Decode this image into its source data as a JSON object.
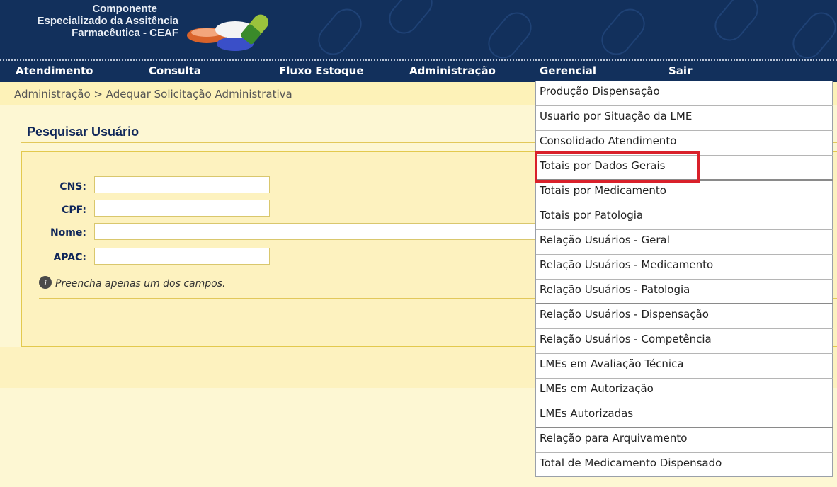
{
  "header": {
    "brand_line1": "Componente",
    "brand_line2": "Especializado da Assitência",
    "brand_line3": "Farmacêutica - CEAF"
  },
  "menu": {
    "atendimento": "Atendimento",
    "consulta": "Consulta",
    "fluxo_estoque": "Fluxo Estoque",
    "administracao": "Administração",
    "gerencial": "Gerencial",
    "sair": "Sair"
  },
  "breadcrumb": "Administração > Adequar Solicitação Administrativa",
  "form": {
    "title": "Pesquisar Usuário",
    "cns_label": "CNS:",
    "cpf_label": "CPF:",
    "nome_label": "Nome:",
    "apac_label": "APAC:",
    "cns_value": "",
    "cpf_value": "",
    "nome_value": "",
    "apac_value": "",
    "hint": "Preencha apenas um dos campos."
  },
  "gerencial_menu": {
    "items": [
      "Produção Dispensação",
      "Usuario por Situação da LME",
      "Consolidado Atendimento",
      "Totais por Dados Gerais",
      "Totais por Medicamento",
      "Totais por Patologia",
      "Relação Usuários - Geral",
      "Relação Usuários - Medicamento",
      "Relação Usuários - Patologia",
      "Relação Usuários - Dispensação",
      "Relação Usuários - Competência",
      "LMEs em Avaliação Técnica",
      "LMEs em Autorização",
      "LMEs Autorizadas",
      "Relação para Arquivamento",
      "Total de Medicamento Dispensado"
    ],
    "highlighted": "Totais por Dados Gerais"
  },
  "colors": {
    "header_bg": "#12305c",
    "content_bg": "#fdf7d3",
    "highlight": "#d9202a"
  },
  "icons": {
    "logo": "medicine-pills-logo",
    "hint": "info-icon"
  }
}
